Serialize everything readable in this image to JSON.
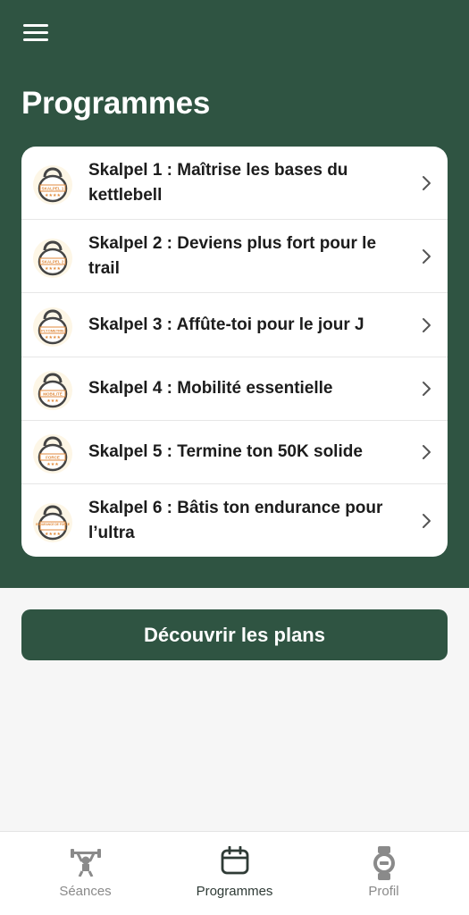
{
  "header": {
    "title": "Programmes",
    "menu_icon": "hamburger-menu-icon"
  },
  "programs": [
    {
      "label": "Skalpel 1 : Maîtrise les bases du kettlebell",
      "badge": "SKALPEL 1"
    },
    {
      "label": "Skalpel 2 : Deviens plus fort pour le trail",
      "badge": "SKALPEL 2"
    },
    {
      "label": "Skalpel 3 : Affûte-toi pour le jour J",
      "badge": "PLYOMETRIE"
    },
    {
      "label": "Skalpel 4 : Mobilité essentielle",
      "badge": "MOBILITÉ"
    },
    {
      "label": "Skalpel 5 : Termine ton 50K solide",
      "badge": "FORCE"
    },
    {
      "label": "Skalpel 6 : Bâtis ton endurance pour l’ultra",
      "badge": "ENDURANCE DE FORCE"
    }
  ],
  "cta": {
    "label": "Découvrir les plans"
  },
  "nav": {
    "items": [
      {
        "label": "Séances",
        "icon": "weightlifter-icon"
      },
      {
        "label": "Programmes",
        "icon": "calendar-icon"
      },
      {
        "label": "Profil",
        "icon": "watch-icon"
      }
    ],
    "active": "Programmes"
  },
  "colors": {
    "brand": "#2f5442",
    "background": "#f6f6f6",
    "card": "#ffffff",
    "nav_inactive": "#8a8a8a",
    "nav_active": "#2f3b36",
    "badge_orange": "#e08a3c"
  }
}
